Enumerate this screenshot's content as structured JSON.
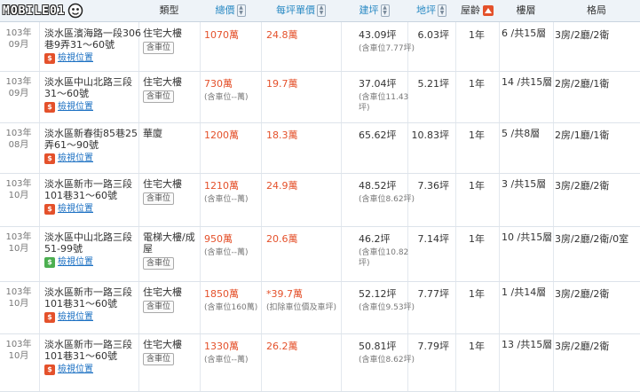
{
  "logo": {
    "text": "MOBILE01"
  },
  "header": {
    "type": "類型",
    "total_price": "總價",
    "unit_price": "每坪單價",
    "build_area": "建坪",
    "land_area": "地坪",
    "age": "屋齡",
    "floor": "樓層",
    "layout": "格局"
  },
  "rows": [
    {
      "year": "103年",
      "month": "09月",
      "addr": "淡水區濱海路一段306巷9弄31～60號",
      "map": "檢視位置",
      "type": "住宅大樓",
      "badge": "含車位",
      "price": "1070萬",
      "price_sub": "",
      "unit": "24.8萬",
      "unit_sub": "",
      "area": "43.09坪",
      "area_sub": "(含車位7.77坪)",
      "land": "6.03坪",
      "age": "1年",
      "floor": "6 /共15層",
      "layout": "3房/2廳/2衛"
    },
    {
      "year": "103年",
      "month": "09月",
      "addr": "淡水區中山北路三段31～60號",
      "map": "檢視位置",
      "type": "住宅大樓",
      "badge": "含車位",
      "price": "730萬",
      "price_sub": "(含車位--萬)",
      "unit": "19.7萬",
      "unit_sub": "",
      "area": "37.04坪",
      "area_sub": "(含車位11.43坪)",
      "land": "5.21坪",
      "age": "1年",
      "floor": "14 /共15層",
      "layout": "2房/2廳/1衛"
    },
    {
      "year": "103年",
      "month": "08月",
      "addr": "淡水區新春街85巷25弄61～90號",
      "map": "檢視位置",
      "type": "華廈",
      "badge": "",
      "price": "1200萬",
      "price_sub": "",
      "unit": "18.3萬",
      "unit_sub": "",
      "area": "65.62坪",
      "area_sub": "",
      "land": "10.83坪",
      "age": "1年",
      "floor": "5 /共8層",
      "layout": "2房/1廳/1衛"
    },
    {
      "year": "103年",
      "month": "10月",
      "addr": "淡水區新市一路三段101巷31～60號",
      "map": "檢視位置",
      "type": "住宅大樓",
      "badge": "含車位",
      "price": "1210萬",
      "price_sub": "(含車位--萬)",
      "unit": "24.9萬",
      "unit_sub": "",
      "area": "48.52坪",
      "area_sub": "(含車位8.62坪)",
      "land": "7.36坪",
      "age": "1年",
      "floor": "3 /共15層",
      "layout": "3房/2廳/2衛"
    },
    {
      "year": "103年",
      "month": "10月",
      "addr": "淡水區中山北路三段51-99號",
      "map": "檢視位置",
      "type": "電梯大樓/成屋",
      "badge": "含車位",
      "price": "950萬",
      "price_sub": "(含車位--萬)",
      "unit": "20.6萬",
      "unit_sub": "",
      "area": "46.2坪",
      "area_sub": "(含車位10.82坪)",
      "land": "7.14坪",
      "age": "1年",
      "floor": "10 /共15層",
      "layout": "3房/2廳/2衛/0室"
    },
    {
      "year": "103年",
      "month": "10月",
      "addr": "淡水區新市一路三段101巷31～60號",
      "map": "檢視位置",
      "type": "住宅大樓",
      "badge": "含車位",
      "price": "1850萬",
      "price_sub": "(含車位160萬)",
      "unit": "*39.7萬",
      "unit_sub": "(扣除車位價及車坪)",
      "area": "52.12坪",
      "area_sub": "(含車位9.53坪)",
      "land": "7.77坪",
      "age": "1年",
      "floor": "1 /共14層",
      "layout": "3房/2廳/2衛"
    },
    {
      "year": "103年",
      "month": "10月",
      "addr": "淡水區新市一路三段101巷31～60號",
      "map": "檢視位置",
      "type": "住宅大樓",
      "badge": "含車位",
      "price": "1330萬",
      "price_sub": "(含車位--萬)",
      "unit": "26.2萬",
      "unit_sub": "",
      "area": "50.81坪",
      "area_sub": "(含車位8.62坪)",
      "land": "7.79坪",
      "age": "1年",
      "floor": "13 /共15層",
      "layout": "3房/2廳/2衛"
    }
  ]
}
